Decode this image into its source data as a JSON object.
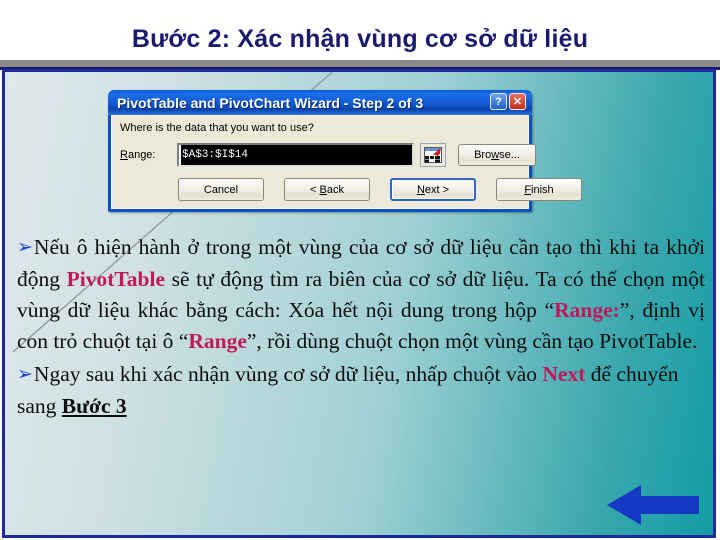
{
  "slide": {
    "title": "Bước 2: Xác nhận vùng cơ sở dữ liệu",
    "accent_navy": "#1a1a6e",
    "accent_pink": "#c2185b",
    "panel_border": "#1c2a9b",
    "arrow_color": "#1639c4"
  },
  "dialog": {
    "title": "PivotTable and PivotChart Wizard - Step 2 of 3",
    "help_button": "?",
    "close_button": "✕",
    "prompt": "Where is the data that you want to use?",
    "range_label": "Range:",
    "range_label_accesskey": "R",
    "range_value": "$A$3:$I$14",
    "range_picker_icon": "range-select-icon",
    "browse_label": "Browse...",
    "browse_accesskey": "w",
    "buttons": [
      {
        "label": "Cancel",
        "name": "cancel-button",
        "accesskey": "",
        "focused": false
      },
      {
        "label": "< Back",
        "name": "back-button",
        "accesskey": "B",
        "focused": false
      },
      {
        "label": "Next >",
        "name": "next-button",
        "accesskey": "N",
        "focused": true
      },
      {
        "label": "Finish",
        "name": "finish-button",
        "accesskey": "F",
        "focused": false
      }
    ]
  },
  "content": {
    "bullet_glyph": "➢",
    "paragraph1": {
      "t1": "Nếu ô hiện hành ở trong một vùng của cơ sở dữ liệu cần tạo  thì khi ta khởi động ",
      "em1": "PivotTable",
      "t2": " sẽ tự động tìm ra biên của cơ sở dữ liệu. Ta có thể chọn một vùng dữ liệu khác bằng cách: Xóa hết nội dung trong hộp “",
      "em2": "Range:",
      "t3": "”, định vị con trỏ chuột tại ô “",
      "em3": "Range",
      "t4": "”, rồi dùng chuột chọn một vùng cần tạo PivotTable."
    },
    "paragraph2": {
      "t1": "Ngay sau khi xác nhận vùng cơ sở dữ liệu, nhấp chuột vào ",
      "em1": "Next",
      "t2": " để chuyển sang ",
      "em2": "Bước 3"
    }
  }
}
